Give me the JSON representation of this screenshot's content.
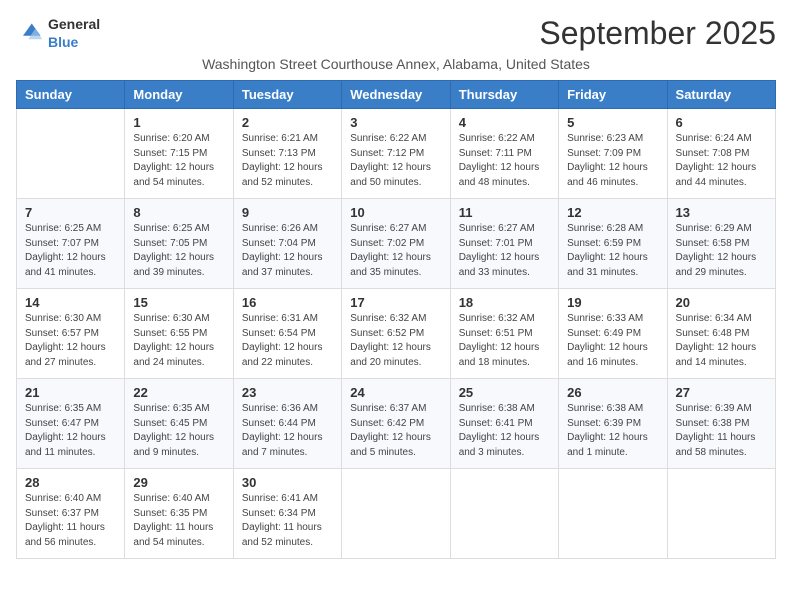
{
  "logo": {
    "general": "General",
    "blue": "Blue"
  },
  "title": "September 2025",
  "location": "Washington Street Courthouse Annex, Alabama, United States",
  "days_of_week": [
    "Sunday",
    "Monday",
    "Tuesday",
    "Wednesday",
    "Thursday",
    "Friday",
    "Saturday"
  ],
  "weeks": [
    [
      {
        "day": "",
        "sunrise": "",
        "sunset": "",
        "daylight": ""
      },
      {
        "day": "1",
        "sunrise": "Sunrise: 6:20 AM",
        "sunset": "Sunset: 7:15 PM",
        "daylight": "Daylight: 12 hours and 54 minutes."
      },
      {
        "day": "2",
        "sunrise": "Sunrise: 6:21 AM",
        "sunset": "Sunset: 7:13 PM",
        "daylight": "Daylight: 12 hours and 52 minutes."
      },
      {
        "day": "3",
        "sunrise": "Sunrise: 6:22 AM",
        "sunset": "Sunset: 7:12 PM",
        "daylight": "Daylight: 12 hours and 50 minutes."
      },
      {
        "day": "4",
        "sunrise": "Sunrise: 6:22 AM",
        "sunset": "Sunset: 7:11 PM",
        "daylight": "Daylight: 12 hours and 48 minutes."
      },
      {
        "day": "5",
        "sunrise": "Sunrise: 6:23 AM",
        "sunset": "Sunset: 7:09 PM",
        "daylight": "Daylight: 12 hours and 46 minutes."
      },
      {
        "day": "6",
        "sunrise": "Sunrise: 6:24 AM",
        "sunset": "Sunset: 7:08 PM",
        "daylight": "Daylight: 12 hours and 44 minutes."
      }
    ],
    [
      {
        "day": "7",
        "sunrise": "Sunrise: 6:25 AM",
        "sunset": "Sunset: 7:07 PM",
        "daylight": "Daylight: 12 hours and 41 minutes."
      },
      {
        "day": "8",
        "sunrise": "Sunrise: 6:25 AM",
        "sunset": "Sunset: 7:05 PM",
        "daylight": "Daylight: 12 hours and 39 minutes."
      },
      {
        "day": "9",
        "sunrise": "Sunrise: 6:26 AM",
        "sunset": "Sunset: 7:04 PM",
        "daylight": "Daylight: 12 hours and 37 minutes."
      },
      {
        "day": "10",
        "sunrise": "Sunrise: 6:27 AM",
        "sunset": "Sunset: 7:02 PM",
        "daylight": "Daylight: 12 hours and 35 minutes."
      },
      {
        "day": "11",
        "sunrise": "Sunrise: 6:27 AM",
        "sunset": "Sunset: 7:01 PM",
        "daylight": "Daylight: 12 hours and 33 minutes."
      },
      {
        "day": "12",
        "sunrise": "Sunrise: 6:28 AM",
        "sunset": "Sunset: 6:59 PM",
        "daylight": "Daylight: 12 hours and 31 minutes."
      },
      {
        "day": "13",
        "sunrise": "Sunrise: 6:29 AM",
        "sunset": "Sunset: 6:58 PM",
        "daylight": "Daylight: 12 hours and 29 minutes."
      }
    ],
    [
      {
        "day": "14",
        "sunrise": "Sunrise: 6:30 AM",
        "sunset": "Sunset: 6:57 PM",
        "daylight": "Daylight: 12 hours and 27 minutes."
      },
      {
        "day": "15",
        "sunrise": "Sunrise: 6:30 AM",
        "sunset": "Sunset: 6:55 PM",
        "daylight": "Daylight: 12 hours and 24 minutes."
      },
      {
        "day": "16",
        "sunrise": "Sunrise: 6:31 AM",
        "sunset": "Sunset: 6:54 PM",
        "daylight": "Daylight: 12 hours and 22 minutes."
      },
      {
        "day": "17",
        "sunrise": "Sunrise: 6:32 AM",
        "sunset": "Sunset: 6:52 PM",
        "daylight": "Daylight: 12 hours and 20 minutes."
      },
      {
        "day": "18",
        "sunrise": "Sunrise: 6:32 AM",
        "sunset": "Sunset: 6:51 PM",
        "daylight": "Daylight: 12 hours and 18 minutes."
      },
      {
        "day": "19",
        "sunrise": "Sunrise: 6:33 AM",
        "sunset": "Sunset: 6:49 PM",
        "daylight": "Daylight: 12 hours and 16 minutes."
      },
      {
        "day": "20",
        "sunrise": "Sunrise: 6:34 AM",
        "sunset": "Sunset: 6:48 PM",
        "daylight": "Daylight: 12 hours and 14 minutes."
      }
    ],
    [
      {
        "day": "21",
        "sunrise": "Sunrise: 6:35 AM",
        "sunset": "Sunset: 6:47 PM",
        "daylight": "Daylight: 12 hours and 11 minutes."
      },
      {
        "day": "22",
        "sunrise": "Sunrise: 6:35 AM",
        "sunset": "Sunset: 6:45 PM",
        "daylight": "Daylight: 12 hours and 9 minutes."
      },
      {
        "day": "23",
        "sunrise": "Sunrise: 6:36 AM",
        "sunset": "Sunset: 6:44 PM",
        "daylight": "Daylight: 12 hours and 7 minutes."
      },
      {
        "day": "24",
        "sunrise": "Sunrise: 6:37 AM",
        "sunset": "Sunset: 6:42 PM",
        "daylight": "Daylight: 12 hours and 5 minutes."
      },
      {
        "day": "25",
        "sunrise": "Sunrise: 6:38 AM",
        "sunset": "Sunset: 6:41 PM",
        "daylight": "Daylight: 12 hours and 3 minutes."
      },
      {
        "day": "26",
        "sunrise": "Sunrise: 6:38 AM",
        "sunset": "Sunset: 6:39 PM",
        "daylight": "Daylight: 12 hours and 1 minute."
      },
      {
        "day": "27",
        "sunrise": "Sunrise: 6:39 AM",
        "sunset": "Sunset: 6:38 PM",
        "daylight": "Daylight: 11 hours and 58 minutes."
      }
    ],
    [
      {
        "day": "28",
        "sunrise": "Sunrise: 6:40 AM",
        "sunset": "Sunset: 6:37 PM",
        "daylight": "Daylight: 11 hours and 56 minutes."
      },
      {
        "day": "29",
        "sunrise": "Sunrise: 6:40 AM",
        "sunset": "Sunset: 6:35 PM",
        "daylight": "Daylight: 11 hours and 54 minutes."
      },
      {
        "day": "30",
        "sunrise": "Sunrise: 6:41 AM",
        "sunset": "Sunset: 6:34 PM",
        "daylight": "Daylight: 11 hours and 52 minutes."
      },
      {
        "day": "",
        "sunrise": "",
        "sunset": "",
        "daylight": ""
      },
      {
        "day": "",
        "sunrise": "",
        "sunset": "",
        "daylight": ""
      },
      {
        "day": "",
        "sunrise": "",
        "sunset": "",
        "daylight": ""
      },
      {
        "day": "",
        "sunrise": "",
        "sunset": "",
        "daylight": ""
      }
    ]
  ]
}
